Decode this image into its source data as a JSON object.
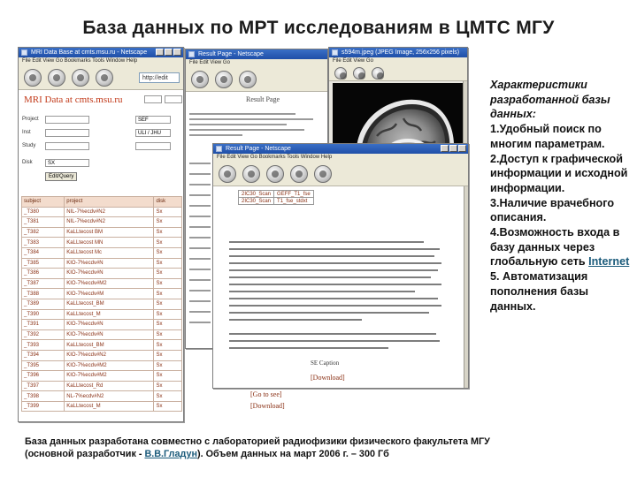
{
  "slide": {
    "title": "База данных по МРТ исследованиям в ЦМТС МГУ"
  },
  "windows": {
    "w1": {
      "titlebar": "MRI Data Base at cmts.msu.ru - Netscape",
      "url": "http://edit",
      "logo": "MRI Data at cmts.msu.ru",
      "form": {
        "field1_value": "SEF",
        "field2_value": "ULI / JHU",
        "search_button": "Edit/Query",
        "disk_value": "SX"
      },
      "table_header": [
        "subject",
        "project",
        "disk"
      ],
      "rows": [
        [
          "_T380",
          "NIL-7%ecdv#N2",
          "Sx"
        ],
        [
          "_T381",
          "NIL-7%ecdv#N2",
          "Sx"
        ],
        [
          "_T382",
          "KaLLtecost BM",
          "Sx"
        ],
        [
          "_T383",
          "KaLLtecost MN",
          "Sx"
        ],
        [
          "_T384",
          "KaLLtecost Mc",
          "Sx"
        ],
        [
          "_T385",
          "KIO-7%ecdv#N",
          "Sx"
        ],
        [
          "_T386",
          "KIO-7%ecdv#N",
          "Sx"
        ],
        [
          "_T387",
          "KIO-7%ecdv#M2",
          "Sx"
        ],
        [
          "_T388",
          "KIO-7%ecdv#M",
          "Sx"
        ],
        [
          "_T389",
          "KaLLtecost_BM",
          "Sx"
        ],
        [
          "_T390",
          "KaLLtecost_M",
          "Sx"
        ],
        [
          "_T391",
          "KIO-7%ecdv#N",
          "Sx"
        ],
        [
          "_T392",
          "KIO-7%ecdv#N",
          "Sx"
        ],
        [
          "_T393",
          "KaLLtecost_BM",
          "Sx"
        ],
        [
          "_T394",
          "KIO-7%ecdv#N2",
          "Sx"
        ],
        [
          "_T395",
          "KIO-7%ecdv#M2",
          "Sx"
        ],
        [
          "_T396",
          "KIO-7%ecdv#M2",
          "Sx"
        ],
        [
          "_T397",
          "KaLLtecost_Rd",
          "Sx"
        ],
        [
          "_T398",
          "NL-7%ecdv#N2",
          "Sx"
        ],
        [
          "_T399",
          "KaLLtecost_M",
          "Sx"
        ]
      ]
    },
    "w2": {
      "titlebar": "Result Page - Netscape",
      "page_title": "Result Page",
      "link": "[Download]"
    },
    "w3": {
      "titlebar": "Result Page - Netscape",
      "cells": [
        "2IC30_Scan",
        "GEFF_T1_fse",
        "2IC30_Scan",
        "T1_fse_stdxt"
      ],
      "caption": "SE Caption",
      "link1": "[Go to see]",
      "link2": "[Download]"
    },
    "w4": {
      "titlebar": "s594m.jpeg (JPEG Image, 256x256 pixels)"
    }
  },
  "side_text": {
    "heading": "Характеристики разработанной базы данных:",
    "item1": "1.Удобный поиск по многим параметрам.",
    "item2": "2.Доступ к графической информации и исходной информации.",
    "item3": "3.Наличие врачебного описания.",
    "item4_text": "4.Возможность входа в базу данных через глобальную сеть",
    "item4_link": "Internet",
    "item5": "5. Автоматизация пополнения базы данных."
  },
  "footer": {
    "text_before": "База данных разработана совместно с лабораторией радиофизики физического факультета МГУ (основной разработчик - ",
    "link": "В.В.Гладун",
    "text_after": "). Объем данных на март 2006 г. – 300 Гб"
  }
}
